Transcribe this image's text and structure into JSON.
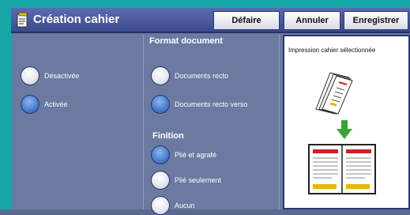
{
  "header": {
    "title": "Création cahier",
    "undo_label": "Défaire",
    "cancel_label": "Annuler",
    "save_label": "Enregistrer"
  },
  "left_options": [
    {
      "label": "Désactivée",
      "selected": false
    },
    {
      "label": "Activée",
      "selected": true
    }
  ],
  "format": {
    "title": "Format document",
    "options": [
      {
        "label": "Documents recto",
        "selected": false
      },
      {
        "label": "Documents recto verso",
        "selected": true
      }
    ]
  },
  "finition": {
    "title": "Finition",
    "options": [
      {
        "label": "Plié et agrafé",
        "selected": true
      },
      {
        "label": "Plié seulement",
        "selected": false
      },
      {
        "label": "Aucun",
        "selected": false
      }
    ]
  },
  "preview": {
    "caption": "Impression cahier sélectionnée"
  },
  "colors": {
    "accent_teal": "#18a7a8",
    "header_blue": "#3c4a8c",
    "panel": "#6c7aa1",
    "arrow_green": "#3aa335"
  }
}
